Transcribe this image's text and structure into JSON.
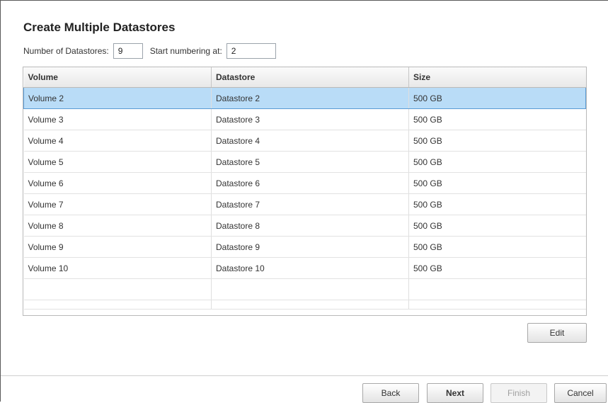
{
  "title": "Create Multiple Datastores",
  "options": {
    "count_label": "Number of Datastores:",
    "count_value": "9",
    "start_label": "Start numbering at:",
    "start_value": "2"
  },
  "table": {
    "columns": [
      "Volume",
      "Datastore",
      "Size"
    ],
    "rows": [
      {
        "volume": "Volume 2",
        "datastore": "Datastore 2",
        "size": "500 GB"
      },
      {
        "volume": "Volume 3",
        "datastore": "Datastore 3",
        "size": "500 GB"
      },
      {
        "volume": "Volume 4",
        "datastore": "Datastore 4",
        "size": "500 GB"
      },
      {
        "volume": "Volume 5",
        "datastore": "Datastore 5",
        "size": "500 GB"
      },
      {
        "volume": "Volume 6",
        "datastore": "Datastore 6",
        "size": "500 GB"
      },
      {
        "volume": "Volume 7",
        "datastore": "Datastore 7",
        "size": "500 GB"
      },
      {
        "volume": "Volume 8",
        "datastore": "Datastore 8",
        "size": "500 GB"
      },
      {
        "volume": "Volume 9",
        "datastore": "Datastore 9",
        "size": "500 GB"
      },
      {
        "volume": "Volume 10",
        "datastore": "Datastore 10",
        "size": "500 GB"
      }
    ]
  },
  "buttons": {
    "edit": "Edit",
    "back": "Back",
    "next": "Next",
    "finish": "Finish",
    "cancel": "Cancel"
  },
  "colors": {
    "selected_row": "#b9dcf7",
    "selected_border": "#5b9bd5"
  }
}
